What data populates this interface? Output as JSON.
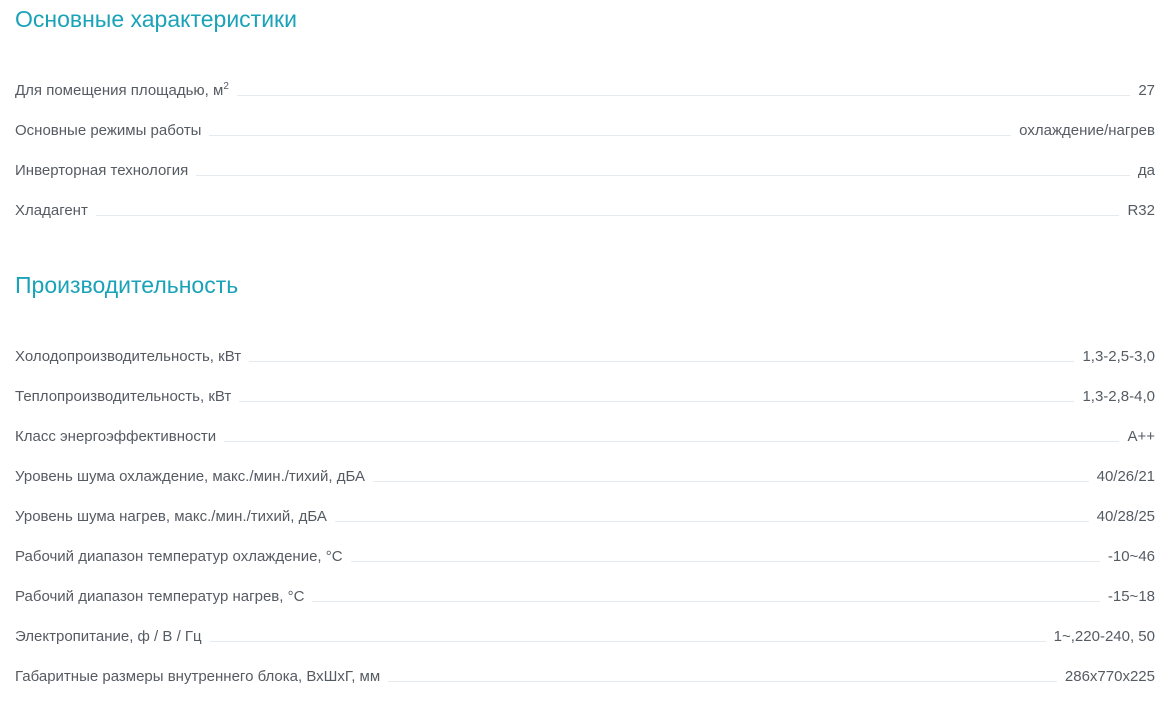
{
  "sections": [
    {
      "title": "Основные характеристики",
      "rows": [
        {
          "label": "Для помещения площадью, м",
          "label_sup": "2",
          "value": "27"
        },
        {
          "label": "Основные режимы работы",
          "value": "охлаждение/нагрев"
        },
        {
          "label": "Инверторная технология",
          "value": "да"
        },
        {
          "label": "Хладагент",
          "value": "R32"
        }
      ]
    },
    {
      "title": "Производительность",
      "rows": [
        {
          "label": "Холодопроизводительность, кВт",
          "value": "1,3-2,5-3,0"
        },
        {
          "label": "Теплопроизводительность, кВт",
          "value": "1,3-2,8-4,0"
        },
        {
          "label": "Класс энергоэффективности",
          "value": "A++"
        },
        {
          "label": "Уровень шума охлаждение, макс./мин./тихий, дБА",
          "value": "40/26/21"
        },
        {
          "label": "Уровень шума нагрев, макс./мин./тихий, дБА",
          "value": "40/28/25"
        },
        {
          "label": "Рабочий диапазон температур охлаждение, °С",
          "value": "-10~46"
        },
        {
          "label": "Рабочий диапазон температур нагрев, °С",
          "value": "-15~18"
        },
        {
          "label": "Электропитание, ф / В / Гц",
          "value": "1~,220-240, 50"
        },
        {
          "label": "Габаритные размеры внутреннего блока, ВхШхГ, мм",
          "value": "286x770x225"
        }
      ]
    }
  ],
  "colors": {
    "heading": "#1aa3b8",
    "text": "#555b63",
    "leader_line": "#e4eaee"
  }
}
